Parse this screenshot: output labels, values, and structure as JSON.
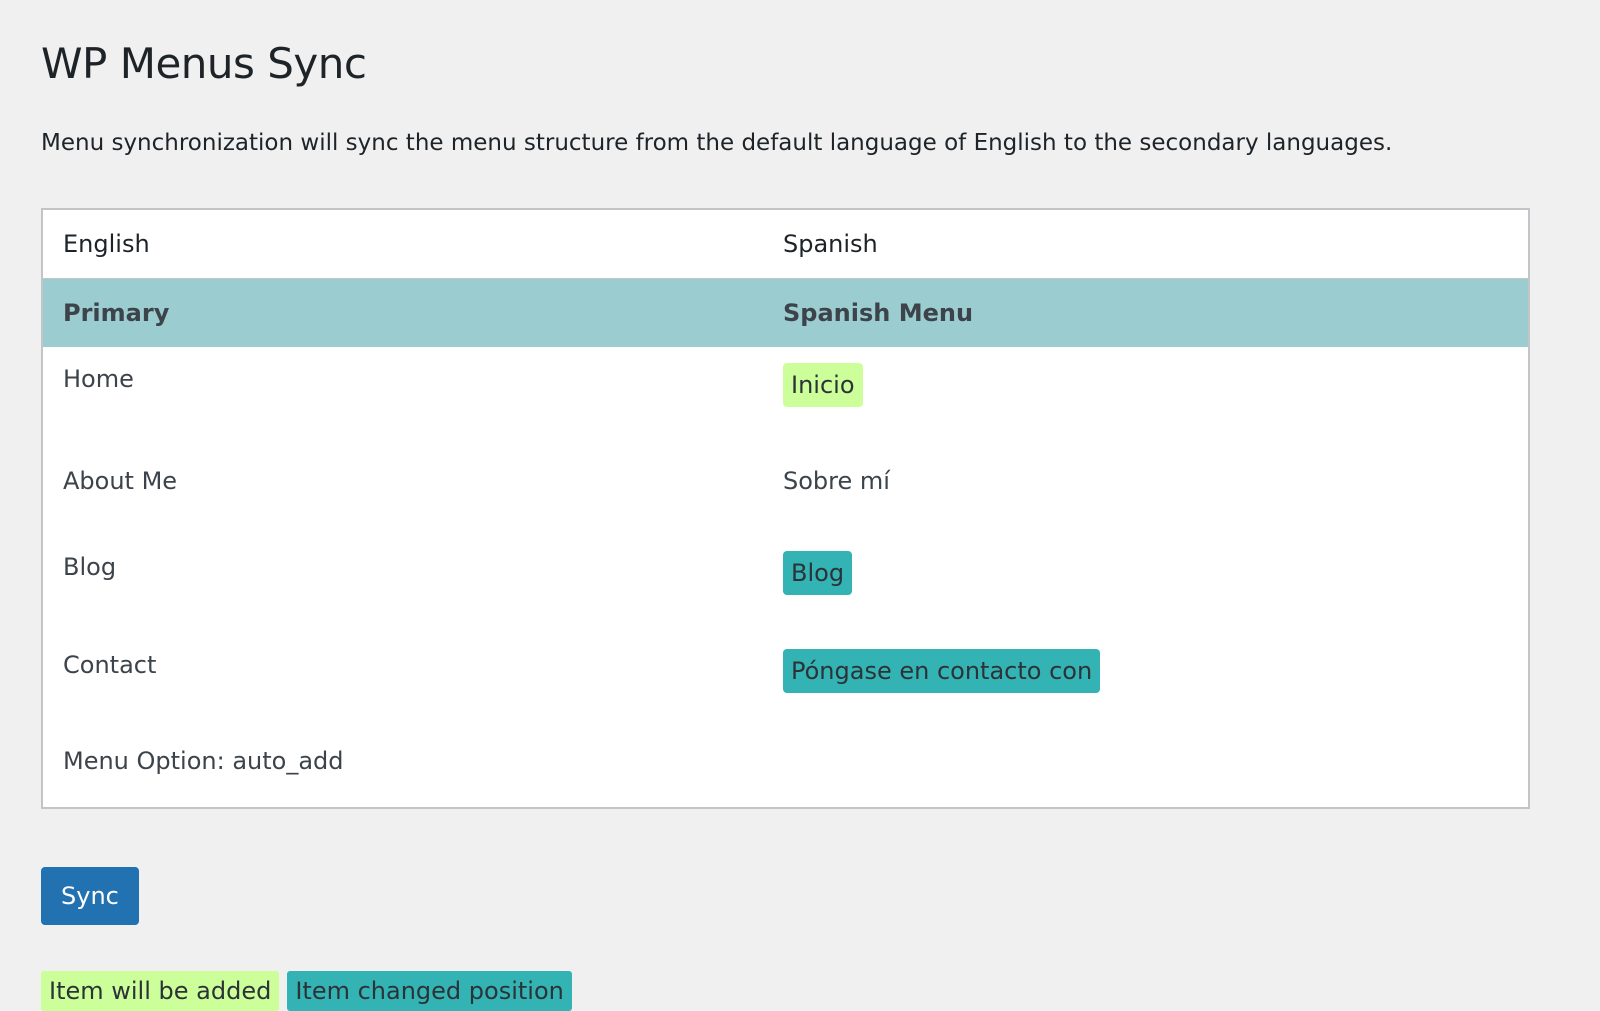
{
  "page": {
    "title": "WP Menus Sync",
    "description": "Menu synchronization will sync the menu structure from the default language of English to the secondary languages."
  },
  "table": {
    "headers": [
      "English",
      "Spanish"
    ],
    "menu_row": [
      "Primary",
      "Spanish Menu"
    ],
    "rows": [
      {
        "english": "Home",
        "spanish": "Inicio",
        "status": "added"
      },
      {
        "english": "About Me",
        "spanish": "Sobre mí",
        "status": "none"
      },
      {
        "english": "Blog",
        "spanish": "Blog",
        "status": "moved"
      },
      {
        "english": "Contact",
        "spanish": "Póngase en contacto con",
        "status": "moved"
      }
    ],
    "option_row": "Menu Option: auto_add"
  },
  "actions": {
    "sync_label": "Sync"
  },
  "legend": {
    "added_label": "Item will be added",
    "moved_label": "Item changed position"
  },
  "colors": {
    "background": "#f0f0f1",
    "menu_row": "#9bcccf",
    "added": "#ccff99",
    "moved": "#33b3b3",
    "button": "#2271b1"
  }
}
